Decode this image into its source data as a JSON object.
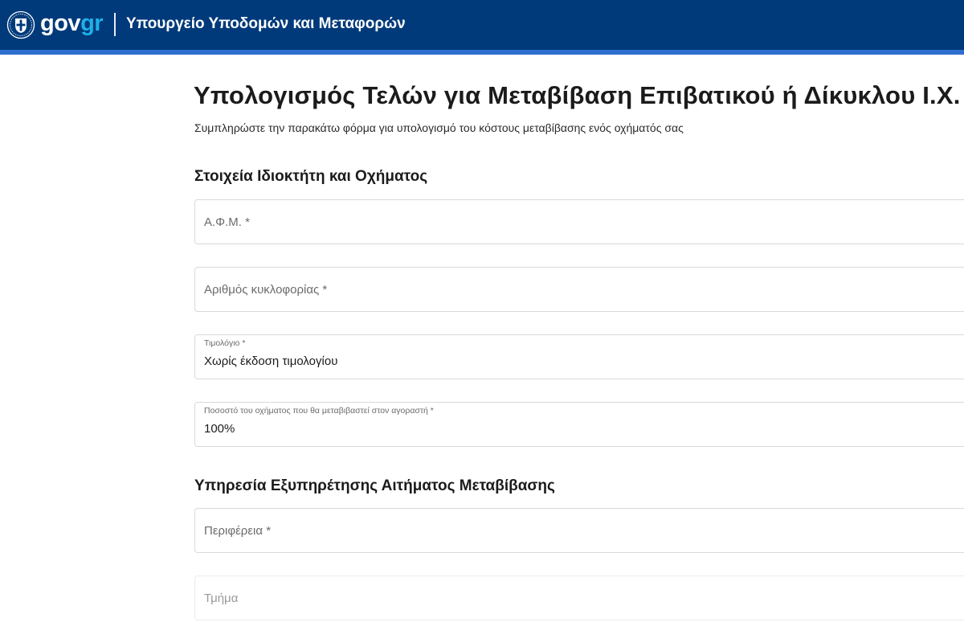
{
  "header": {
    "brand_gov": "gov",
    "brand_gr": "gr",
    "ministry": "Υπουργείο Υποδομών και Μεταφορών",
    "emblem_icon": "greek-coat-of-arms-icon",
    "background_color": "#003a7a",
    "stripe_color": "#2e6fcf",
    "brand_accent_color": "#1eb0e8"
  },
  "page": {
    "title": "Υπολογισμός Τελών για Μεταβίβαση Επιβατικού ή Δίκυκλου Ι.Χ.",
    "subtitle": "Συμπληρώστε την παρακάτω φόρμα για υπολογισμό του κόστους μεταβίβασης ενός οχήματός σας"
  },
  "section_owner": {
    "title": "Στοιχεία Ιδιοκτήτη και Οχήματος",
    "afm": {
      "placeholder": "Α.Φ.Μ. *"
    },
    "plate": {
      "placeholder": "Αριθμός κυκλοφορίας *"
    },
    "invoice": {
      "label": "Τιμολόγιο *",
      "value": "Χωρίς έκδοση τιμολογίου"
    },
    "percentage": {
      "label": "Ποσοστό του οχήματος που θα μεταβιβαστεί στον αγοραστή *",
      "value": "100%"
    }
  },
  "section_service": {
    "title": "Υπηρεσία Εξυπηρέτησης Αιτήματος Μεταβίβασης",
    "region": {
      "placeholder": "Περιφέρεια *"
    },
    "department": {
      "placeholder": "Τμήμα"
    }
  }
}
